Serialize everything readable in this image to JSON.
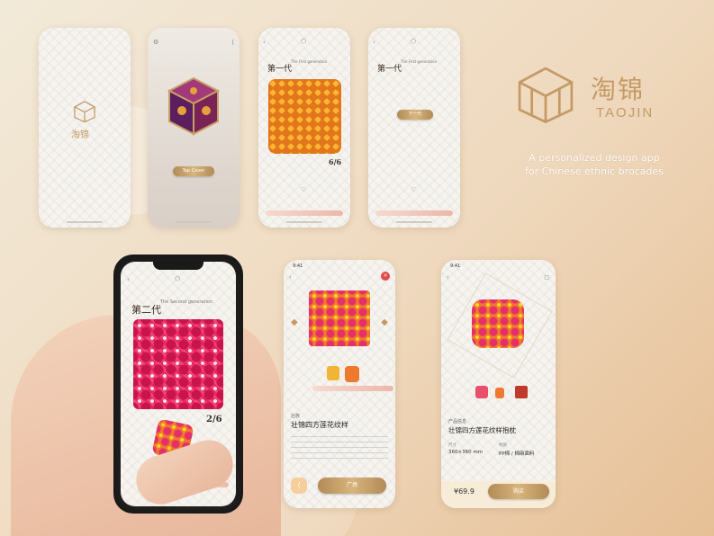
{
  "brand": {
    "name_cn": "淘锦",
    "name_en": "TAOJIN",
    "tagline_line1": "A personalized design app",
    "tagline_line2": "for Chinese ethnic brocades"
  },
  "screen1": {
    "logo_cn": "淘锦"
  },
  "screen2": {
    "button": "Tap Cover"
  },
  "screen3": {
    "title": "第一代",
    "subtitle": "The First generation",
    "count": "6/6"
  },
  "screen4": {
    "title": "第一代",
    "subtitle": "The First generation",
    "button": "下一代"
  },
  "screen5": {
    "title": "第二代",
    "subtitle": "The Second generation",
    "count": "2/6"
  },
  "screen6": {
    "category": "壮族",
    "title": "壮锦四方莲花纹样",
    "button": "广场"
  },
  "screen7": {
    "label": "产品信息",
    "title": "壮锦四方莲花纹样抱枕",
    "size_label": "尺寸",
    "size": "360×360",
    "size_unit": "mm",
    "material_label": "材质",
    "material": "PP棉 / 棉麻面料",
    "price": "¥69.9",
    "button": "购买"
  },
  "colors": {
    "gold": "#c49a64",
    "accent": "#b28a56"
  }
}
